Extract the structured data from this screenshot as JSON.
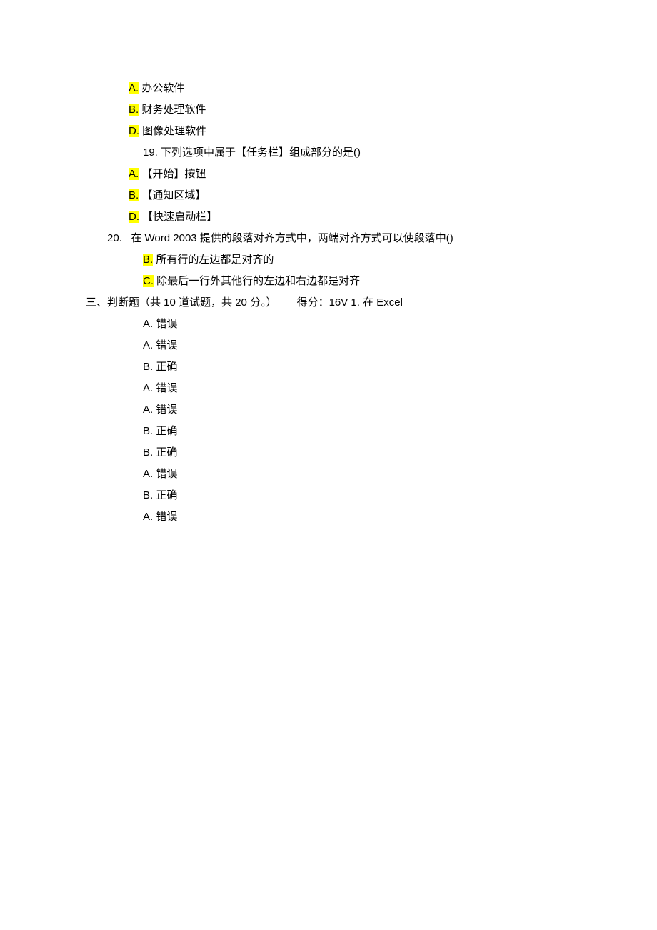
{
  "lines": [
    {
      "indent": "indent-1",
      "highlight": true,
      "letter": "A.",
      "text": " 办公软件"
    },
    {
      "indent": "indent-1",
      "highlight": true,
      "letter": "B.",
      "text": " 财务处理软件"
    },
    {
      "indent": "indent-1",
      "highlight": true,
      "letter": "D.",
      "text": " 图像处理软件"
    },
    {
      "indent": "indent-2",
      "highlight": false,
      "letter": "19.",
      "text": "   下列选项中属于【任务栏】组成部分的是()"
    },
    {
      "indent": "indent-1",
      "highlight": true,
      "letter": "A.",
      "text": " 【开始】按钮"
    },
    {
      "indent": "indent-1",
      "highlight": true,
      "letter": "B.",
      "text": " 【通知区域】"
    },
    {
      "indent": "indent-1",
      "highlight": true,
      "letter": "D.",
      "text": " 【快速启动栏】"
    }
  ],
  "q20": {
    "prefix": "20.   在 ",
    "eng": "Word 2003",
    "suffix": " 提供的段落对齐方式中，两端对齐方式可以使段落中()"
  },
  "q20b": {
    "letter": "B.",
    "text": " 所有行的左边都是对齐的"
  },
  "q20c": {
    "letter": "C.",
    "text": " 除最后一行外其他行的左边和右边都是对齐"
  },
  "section3": {
    "prefix": "三、判断题（共 ",
    "n1": "10",
    "mid1": " 道试题，共 ",
    "n2": "20",
    "mid2": " 分。）",
    "score_label": "得分：",
    "score": "16V 1.",
    "tail": "   在 ",
    "eng": "Excel"
  },
  "tf": [
    {
      "letter": "A.",
      "text": " 错误"
    },
    {
      "letter": "A.",
      "text": " 错误"
    },
    {
      "letter": "B.",
      "text": " 正确"
    },
    {
      "letter": "A.",
      "text": " 错误"
    },
    {
      "letter": "A.",
      "text": " 错误"
    },
    {
      "letter": "B.",
      "text": " 正确"
    },
    {
      "letter": "B.",
      "text": " 正确"
    },
    {
      "letter": "A.",
      "text": " 错误"
    },
    {
      "letter": "B.",
      "text": " 正确"
    },
    {
      "letter": "A.",
      "text": " 错误"
    }
  ]
}
